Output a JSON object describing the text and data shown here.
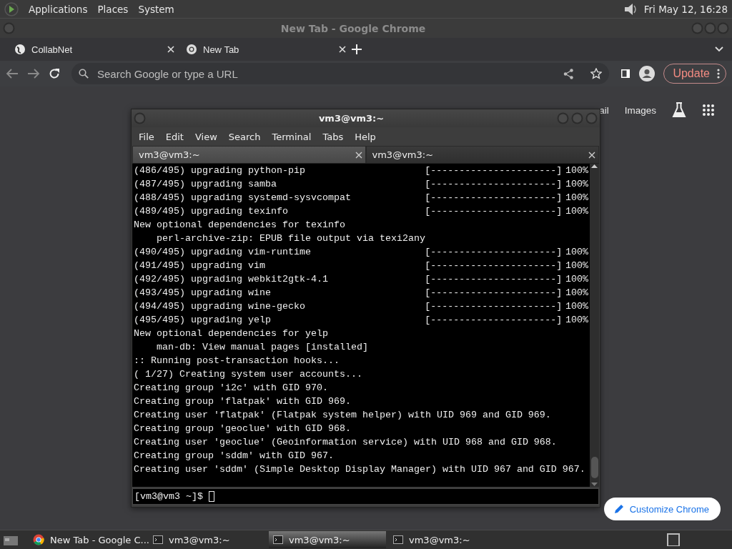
{
  "top_panel": {
    "menus": [
      "Applications",
      "Places",
      "System"
    ],
    "clock": "Fri May 12, 16:28"
  },
  "chrome": {
    "title": "New Tab - Google Chrome",
    "tabs": [
      {
        "label": "CollabNet",
        "kind": "site"
      },
      {
        "label": "New Tab",
        "kind": "newtab"
      }
    ],
    "omnibox": {
      "placeholder": "Search Google or type a URL"
    },
    "update_button": "Update",
    "page_links": [
      "ail",
      "Images"
    ],
    "customize_button": "Customize Chrome"
  },
  "terminal": {
    "title": "vm3@vm3:~",
    "menus": [
      "File",
      "Edit",
      "View",
      "Search",
      "Terminal",
      "Tabs",
      "Help"
    ],
    "tabs": [
      {
        "label": "vm3@vm3:~",
        "selected": true
      },
      {
        "label": "vm3@vm3:~",
        "selected": false
      }
    ],
    "lines": [
      {
        "kind": "progress",
        "text": "(486/495) upgrading python-pip",
        "bar": "[----------------------]",
        "percent": "100%"
      },
      {
        "kind": "progress",
        "text": "(487/495) upgrading samba",
        "bar": "[----------------------]",
        "percent": "100%"
      },
      {
        "kind": "progress",
        "text": "(488/495) upgrading systemd-sysvcompat",
        "bar": "[----------------------]",
        "percent": "100%"
      },
      {
        "kind": "progress",
        "text": "(489/495) upgrading texinfo",
        "bar": "[----------------------]",
        "percent": "100%"
      },
      {
        "kind": "text",
        "text": "New optional dependencies for texinfo"
      },
      {
        "kind": "detail",
        "text": "perl-archive-zip: EPUB file output via texi2any"
      },
      {
        "kind": "progress",
        "text": "(490/495) upgrading vim-runtime",
        "bar": "[----------------------]",
        "percent": "100%"
      },
      {
        "kind": "progress",
        "text": "(491/495) upgrading vim",
        "bar": "[----------------------]",
        "percent": "100%"
      },
      {
        "kind": "progress",
        "text": "(492/495) upgrading webkit2gtk-4.1",
        "bar": "[----------------------]",
        "percent": "100%"
      },
      {
        "kind": "progress",
        "text": "(493/495) upgrading wine",
        "bar": "[----------------------]",
        "percent": "100%"
      },
      {
        "kind": "progress",
        "text": "(494/495) upgrading wine-gecko",
        "bar": "[----------------------]",
        "percent": "100%"
      },
      {
        "kind": "progress",
        "text": "(495/495) upgrading yelp",
        "bar": "[----------------------]",
        "percent": "100%"
      },
      {
        "kind": "text",
        "text": "New optional dependencies for yelp"
      },
      {
        "kind": "detail",
        "text": "man-db: View manual pages [installed]"
      },
      {
        "kind": "text",
        "text": ":: Running post-transaction hooks..."
      },
      {
        "kind": "text",
        "text": "( 1/27) Creating system user accounts..."
      },
      {
        "kind": "text",
        "text": "Creating group 'i2c' with GID 970."
      },
      {
        "kind": "text",
        "text": "Creating group 'flatpak' with GID 969."
      },
      {
        "kind": "text",
        "text": "Creating user 'flatpak' (Flatpak system helper) with UID 969 and GID 969."
      },
      {
        "kind": "text",
        "text": "Creating group 'geoclue' with GID 968."
      },
      {
        "kind": "text",
        "text": "Creating user 'geoclue' (Geoinformation service) with UID 968 and GID 968."
      },
      {
        "kind": "text",
        "text": "Creating group 'sddm' with GID 967."
      },
      {
        "kind": "text",
        "text": "Creating user 'sddm' (Simple Desktop Display Manager) with UID 967 and GID 967."
      }
    ],
    "prompt": "[vm3@vm3 ~]$"
  },
  "taskbar": {
    "items": [
      {
        "label": "New Tab - Google C...",
        "kind": "browser",
        "selected": false
      },
      {
        "label": "vm3@vm3:~",
        "kind": "terminal",
        "selected": false
      },
      {
        "label": "vm3@vm3:~",
        "kind": "terminal",
        "selected": true
      },
      {
        "label": "vm3@vm3:~",
        "kind": "terminal",
        "selected": false
      }
    ]
  }
}
